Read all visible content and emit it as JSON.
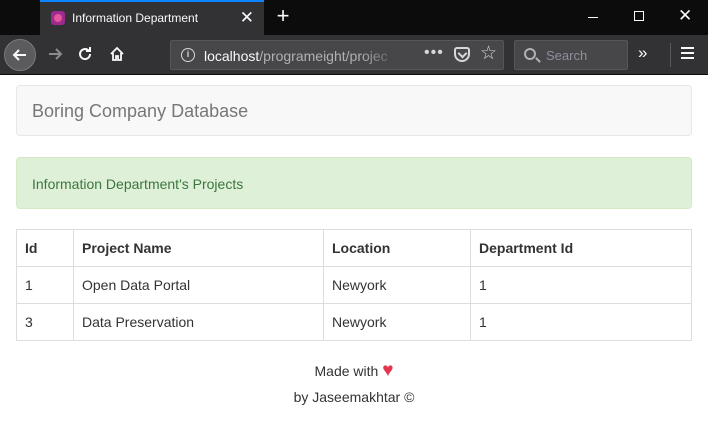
{
  "browser": {
    "tab_title": "Information Department",
    "tab_close": "✕",
    "new_tab": "+",
    "url_host": "localhost",
    "url_path": "/programeight/projec",
    "page_actions": "•••",
    "star": "☆",
    "search_placeholder": "Search",
    "overflow": "»",
    "close_window": "✕"
  },
  "page": {
    "brand": "Boring Company Database",
    "alert": "Information Department's Projects",
    "table": {
      "headers": [
        "Id",
        "Project Name",
        "Location",
        "Department Id"
      ],
      "rows": [
        [
          "1",
          "Open Data Portal",
          "Newyork",
          "1"
        ],
        [
          "3",
          "Data Preservation",
          "Newyork",
          "1"
        ]
      ]
    },
    "footer": {
      "made_with": "Made with",
      "heart": "♥",
      "byline": "by Jaseemakhtar ©"
    }
  },
  "colors": {
    "accent": "#0a84ff",
    "alert_bg": "#dff0d8",
    "alert_text": "#3c763d",
    "heart": "#e2364f"
  }
}
